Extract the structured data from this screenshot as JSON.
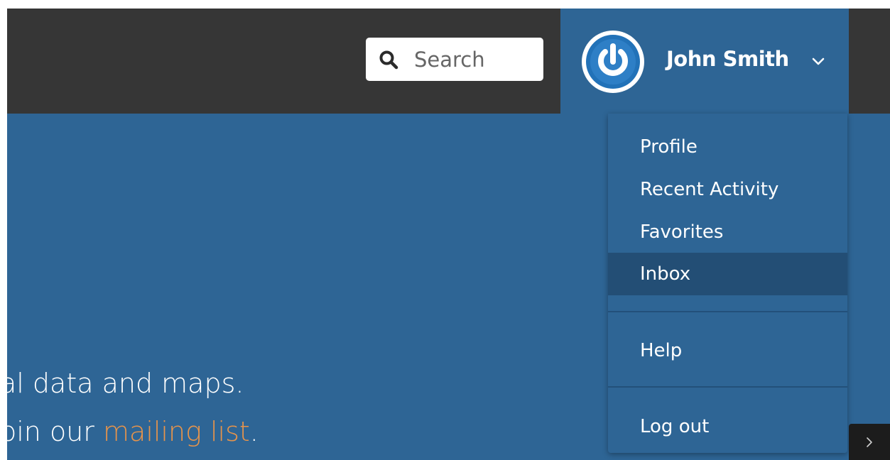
{
  "search": {
    "placeholder": "Search",
    "icon": "search-icon"
  },
  "user": {
    "name": "John Smith",
    "avatar_icon": "power-icon",
    "avatar_ring_color": "#2272b8"
  },
  "hero": {
    "line1": "al data and maps.",
    "line2_prefix": "oin our ",
    "line2_link": "mailing list",
    "line2_suffix": "."
  },
  "menu": {
    "items": [
      {
        "label": "Profile"
      },
      {
        "label": "Recent Activity"
      },
      {
        "label": "Favorites"
      },
      {
        "label": "Inbox",
        "active": true
      },
      {
        "label": "Help"
      },
      {
        "label": "Log out"
      }
    ]
  },
  "colors": {
    "topbar": "#363636",
    "brand_blue": "#2e6595",
    "active_item": "#234e75",
    "link_orange": "#e8944a"
  }
}
